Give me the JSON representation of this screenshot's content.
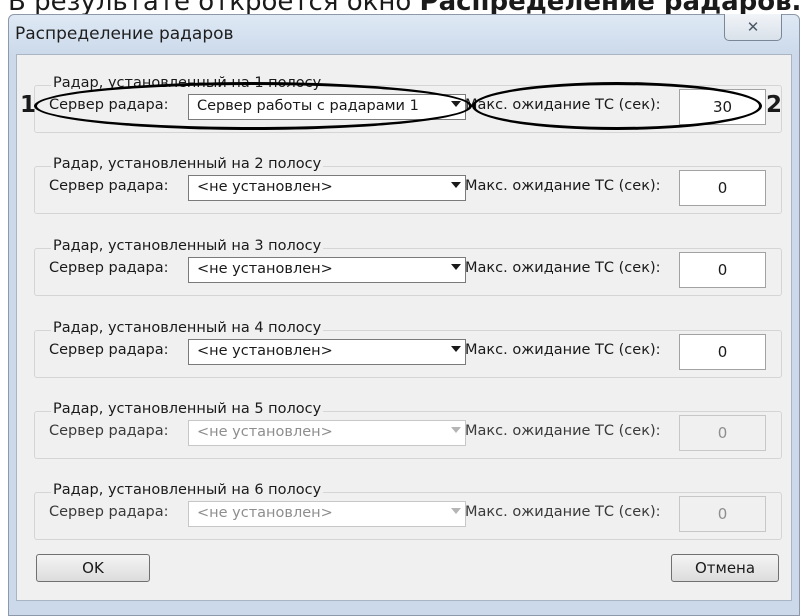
{
  "doc_caption": {
    "prefix": "В результате откроется окно ",
    "bold": "Распределение радаров."
  },
  "window": {
    "title": "Распределение радаров",
    "close_icon": "close-x-icon"
  },
  "groups": [
    {
      "title": "Радар, установленный на 1 полосу",
      "server_label": "Сервер радара:",
      "server_value": "Сервер работы с радарами 1",
      "wait_label": "Макс. ожидание ТС (сек):",
      "wait_value": "30",
      "enabled": true
    },
    {
      "title": "Радар, установленный на 2 полосу",
      "server_label": "Сервер радара:",
      "server_value": "<не установлен>",
      "wait_label": "Макс. ожидание ТС (сек):",
      "wait_value": "0",
      "enabled": true
    },
    {
      "title": "Радар, установленный на 3 полосу",
      "server_label": "Сервер радара:",
      "server_value": "<не установлен>",
      "wait_label": "Макс. ожидание ТС (сек):",
      "wait_value": "0",
      "enabled": true
    },
    {
      "title": "Радар, установленный на 4 полосу",
      "server_label": "Сервер радара:",
      "server_value": "<не установлен>",
      "wait_label": "Макс. ожидание ТС (сек):",
      "wait_value": "0",
      "enabled": true
    },
    {
      "title": "Радар, установленный на 5 полосу",
      "server_label": "Сервер радара:",
      "server_value": "<не установлен>",
      "wait_label": "Макс. ожидание ТС (сек):",
      "wait_value": "0",
      "enabled": false
    },
    {
      "title": "Радар, установленный на 6 полосу",
      "server_label": "Сервер радара:",
      "server_value": "<не установлен>",
      "wait_label": "Макс. ожидание ТС (сек):",
      "wait_value": "0",
      "enabled": false
    }
  ],
  "buttons": {
    "ok": "OK",
    "cancel": "Отмена"
  },
  "callouts": {
    "one": "1",
    "two": "2"
  }
}
